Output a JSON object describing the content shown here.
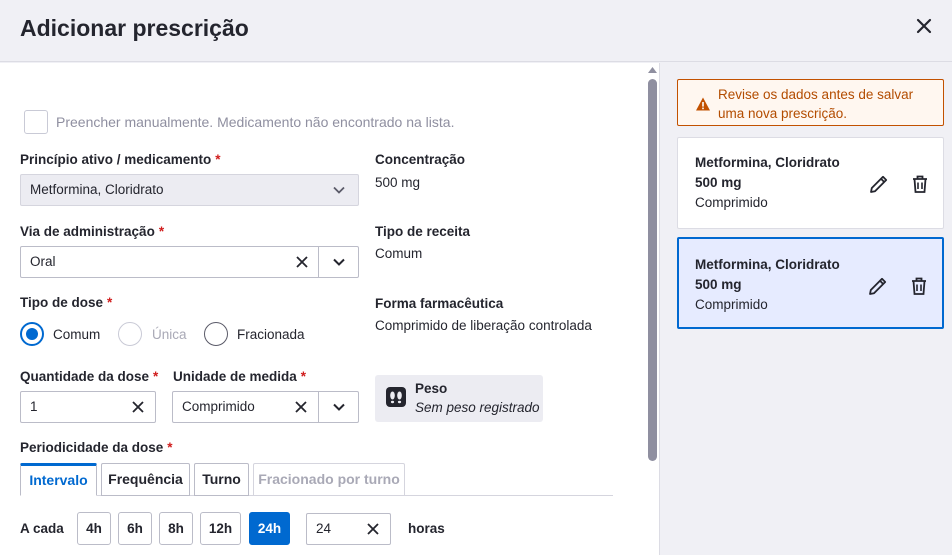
{
  "header": {
    "title": "Adicionar prescrição"
  },
  "form": {
    "manual_checkbox_label": "Preencher manualmente. Medicamento não encontrado na lista.",
    "medicamento": {
      "label": "Princípio ativo / medicamento",
      "required": "*",
      "value": "Metformina, Cloridrato"
    },
    "concentracao": {
      "label": "Concentração",
      "value": "500 mg"
    },
    "via": {
      "label": "Via de administração",
      "required": "*",
      "value": "Oral"
    },
    "tipo_receita": {
      "label": "Tipo de receita",
      "value": "Comum"
    },
    "tipo_dose": {
      "label": "Tipo de dose",
      "required": "*",
      "options": [
        "Comum",
        "Única",
        "Fracionada"
      ],
      "selected": "Comum"
    },
    "forma": {
      "label": "Forma farmacêutica",
      "value": "Comprimido de liberação controlada"
    },
    "quantidade": {
      "label": "Quantidade da dose",
      "required": "*",
      "value": "1"
    },
    "unidade": {
      "label": "Unidade de medida",
      "required": "*",
      "value": "Comprimido"
    },
    "peso": {
      "title": "Peso",
      "subtitle": "Sem peso registrado"
    },
    "periodicidade": {
      "label": "Periodicidade da dose",
      "required": "*",
      "tabs": [
        "Intervalo",
        "Frequência",
        "Turno",
        "Fracionado por turno"
      ],
      "active_tab": "Intervalo",
      "a_cada_label": "A cada",
      "hour_options": [
        "4h",
        "6h",
        "8h",
        "12h",
        "24h"
      ],
      "selected_hour": "24h",
      "custom_value": "24",
      "unit_label": "horas"
    }
  },
  "sidebar": {
    "alert": "Revise os dados antes de salvar uma nova prescrição.",
    "cards": [
      {
        "name": "Metformina, Cloridrato",
        "concentration": "500 mg",
        "form": "Comprimido",
        "selected": false
      },
      {
        "name": "Metformina, Cloridrato",
        "concentration": "500 mg",
        "form": "Comprimido",
        "selected": true
      }
    ]
  },
  "colors": {
    "primary": "#0069d0",
    "required": "#d01c1c",
    "warning": "#c25100",
    "warning_bg": "#fff7f0",
    "selected_card_bg": "#e6ebff"
  }
}
